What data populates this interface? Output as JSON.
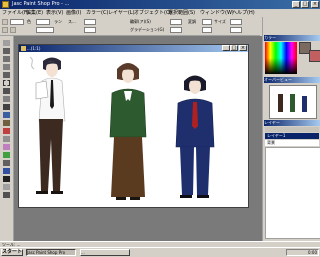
{
  "window": {
    "title": "Jasc Paint Shop Pro - ...",
    "min": "_",
    "max": "□",
    "close": "×"
  },
  "menubar": {
    "items": [
      "ファイル(F)",
      "編集(E)",
      "表示(V)",
      "画像(I)",
      "カラー(C)",
      "レイヤー(L)",
      "オブジェクト(O)",
      "選択範囲(S)",
      "ウィンドウ(W)",
      "ヘルプ(H)"
    ]
  },
  "toolbar": {
    "labels": [
      "色",
      "ラン",
      "ス...",
      "輪郭(ア)(S)",
      "変調",
      "サイズ",
      "グラデーション(G)"
    ]
  },
  "document": {
    "title": "...(1:1)",
    "min": "_",
    "max": "□",
    "close": "×"
  },
  "panels": {
    "color": "カラー",
    "overview": "オーバービュー",
    "layers": "レイヤー"
  },
  "layers": [
    "背景",
    "レイヤー1"
  ],
  "statusbar": {
    "text": "ツール: ..."
  },
  "taskbar": {
    "start": "スタート",
    "items": [
      "Jasc Paint Shop Pro",
      "..."
    ],
    "clock": "0:00"
  },
  "colors": {
    "accent": "#0a246a",
    "workspace": "#7a7a7a"
  }
}
